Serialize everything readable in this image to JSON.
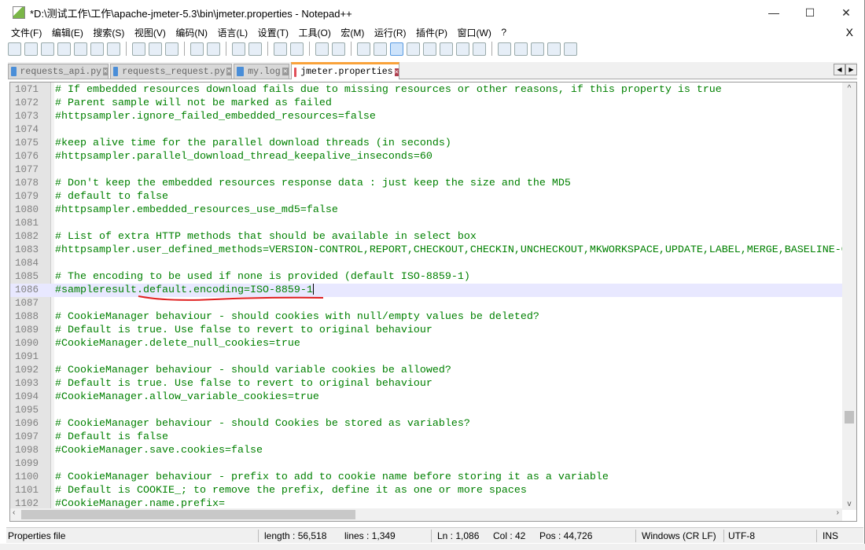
{
  "window": {
    "title": "*D:\\测试工作\\工作\\apache-jmeter-5.3\\bin\\jmeter.properties - Notepad++",
    "minimize": "—",
    "maximize": "☐",
    "close": "✕"
  },
  "menu": [
    "文件(F)",
    "编辑(E)",
    "搜索(S)",
    "视图(V)",
    "编码(N)",
    "语言(L)",
    "设置(T)",
    "工具(O)",
    "宏(M)",
    "运行(R)",
    "插件(P)",
    "窗口(W)",
    "?"
  ],
  "menu_close": "X",
  "toolbar": [
    "new",
    "open",
    "save",
    "save-all",
    "close",
    "close-all",
    "print",
    "cut",
    "copy",
    "paste",
    "undo",
    "redo",
    "find",
    "replace",
    "zoom-in",
    "zoom-out",
    "sync-v",
    "sync-h",
    "word-wrap",
    "show-all-chars",
    "indent-guide",
    "udl",
    "doc-map",
    "function-list",
    "folder-workspace",
    "monitoring",
    "record-macro",
    "stop-record",
    "play-macro",
    "run-multiple",
    "save-macro"
  ],
  "tabs": [
    {
      "label": "requests_api.py",
      "active": false
    },
    {
      "label": "requests_request.py",
      "active": false
    },
    {
      "label": "my.log",
      "active": false
    },
    {
      "label": "jmeter.properties",
      "active": true
    }
  ],
  "editor": {
    "current_line": 1086,
    "comment_color": "#008000",
    "lines": [
      {
        "n": "1071",
        "t": "# If embedded resources download fails due to missing resources or other reasons, if this property is true"
      },
      {
        "n": "1072",
        "t": "# Parent sample will not be marked as failed"
      },
      {
        "n": "1073",
        "t": "#httpsampler.ignore_failed_embedded_resources=false"
      },
      {
        "n": "1074",
        "t": ""
      },
      {
        "n": "1075",
        "t": "#keep alive time for the parallel download threads (in seconds)"
      },
      {
        "n": "1076",
        "t": "#httpsampler.parallel_download_thread_keepalive_inseconds=60"
      },
      {
        "n": "1077",
        "t": ""
      },
      {
        "n": "1078",
        "t": "# Don't keep the embedded resources response data : just keep the size and the MD5"
      },
      {
        "n": "1079",
        "t": "# default to false"
      },
      {
        "n": "1080",
        "t": "#httpsampler.embedded_resources_use_md5=false"
      },
      {
        "n": "1081",
        "t": ""
      },
      {
        "n": "1082",
        "t": "# List of extra HTTP methods that should be available in select box"
      },
      {
        "n": "1083",
        "t": "#httpsampler.user_defined_methods=VERSION-CONTROL,REPORT,CHECKOUT,CHECKIN,UNCHECKOUT,MKWORKSPACE,UPDATE,LABEL,MERGE,BASELINE-CONTROL"
      },
      {
        "n": "1084",
        "t": ""
      },
      {
        "n": "1085",
        "t": "# The encoding to be used if none is provided (default ISO-8859-1)"
      },
      {
        "n": "1086",
        "t": "#sampleresult.default.encoding=ISO-8859-1"
      },
      {
        "n": "1087",
        "t": ""
      },
      {
        "n": "1088",
        "t": "# CookieManager behaviour - should cookies with null/empty values be deleted?"
      },
      {
        "n": "1089",
        "t": "# Default is true. Use false to revert to original behaviour"
      },
      {
        "n": "1090",
        "t": "#CookieManager.delete_null_cookies=true"
      },
      {
        "n": "1091",
        "t": ""
      },
      {
        "n": "1092",
        "t": "# CookieManager behaviour - should variable cookies be allowed?"
      },
      {
        "n": "1093",
        "t": "# Default is true. Use false to revert to original behaviour"
      },
      {
        "n": "1094",
        "t": "#CookieManager.allow_variable_cookies=true"
      },
      {
        "n": "1095",
        "t": ""
      },
      {
        "n": "1096",
        "t": "# CookieManager behaviour - should Cookies be stored as variables?"
      },
      {
        "n": "1097",
        "t": "# Default is false"
      },
      {
        "n": "1098",
        "t": "#CookieManager.save.cookies=false"
      },
      {
        "n": "1099",
        "t": ""
      },
      {
        "n": "1100",
        "t": "# CookieManager behaviour - prefix to add to cookie name before storing it as a variable"
      },
      {
        "n": "1101",
        "t": "# Default is COOKIE_; to remove the prefix, define it as one or more spaces"
      },
      {
        "n": "1102",
        "t": "#CookieManager.name.prefix="
      }
    ]
  },
  "status": {
    "type": "Properties file",
    "length": "length : 56,518",
    "lines": "lines : 1,349",
    "ln": "Ln : 1,086",
    "col": "Col : 42",
    "pos": "Pos : 44,726",
    "eol": "Windows (CR LF)",
    "encoding": "UTF-8",
    "mode": "INS"
  },
  "annotation_color": "#e02020"
}
